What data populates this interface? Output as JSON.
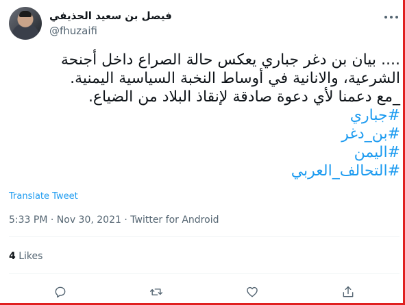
{
  "tweet": {
    "display_name": "فيصل بن سعيد الحذيفي",
    "handle": "@fhuzaifi",
    "text_lines": [
      ".... بيان بن دغر جباري يعكس حالة الصراع داخل أجنحة",
      "الشرعية، والانانية في أوساط النخبة السياسية اليمنية.",
      "_مع دعمنا لأي دعوة صادقة لإنقاذ البلاد من الضياع."
    ],
    "hashtags": [
      "#جباري",
      "#بن_دغر",
      "#اليمن",
      "#التحالف_العربي"
    ],
    "translate_label": "Translate Tweet",
    "time": "5:33 PM",
    "date": "Nov 30, 2021",
    "separator": "·",
    "source": "Twitter for Android",
    "likes_count": "4",
    "likes_label": "Likes"
  },
  "icons": {
    "more": "more-horizontal-icon",
    "reply": "reply-icon",
    "retweet": "retweet-icon",
    "like": "heart-icon",
    "share": "share-icon"
  },
  "colors": {
    "link": "#1d9bf0",
    "secondary": "#536471",
    "primary": "#0f1419",
    "frame": "#e02020"
  }
}
